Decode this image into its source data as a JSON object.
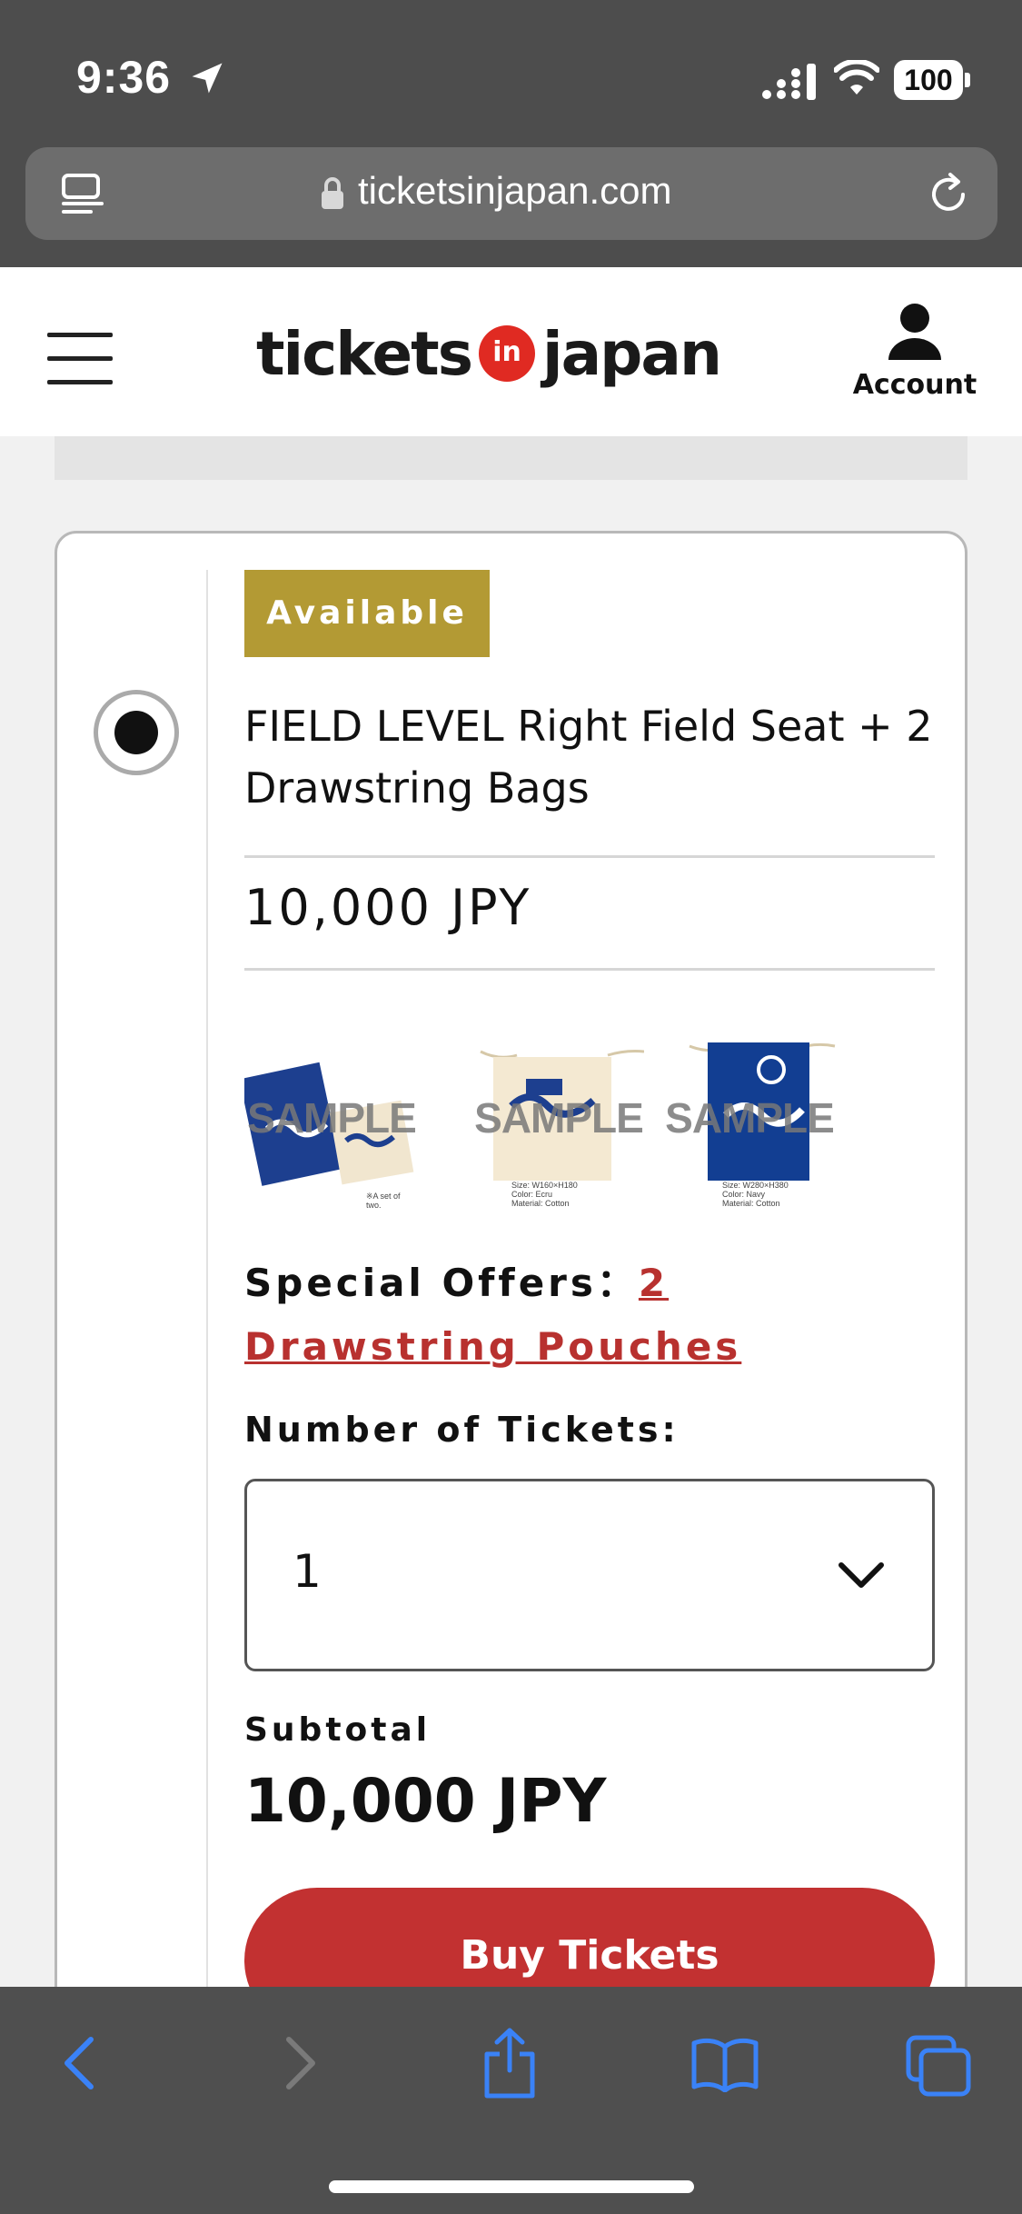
{
  "status_bar": {
    "time": "9:36",
    "battery": "100",
    "icons": [
      "location-arrow-icon",
      "cellular-signal-icon",
      "wifi-icon",
      "battery-icon"
    ]
  },
  "browser": {
    "url": "ticketsinjapan.com",
    "icons": [
      "reader-mode-icon",
      "lock-icon",
      "reload-icon"
    ]
  },
  "header": {
    "logo_left": "tickets",
    "logo_mid": "in",
    "logo_right": "japan",
    "account_label": "Account"
  },
  "ticket": {
    "badge": "Available",
    "title": "FIELD LEVEL Right Field Seat + 2 Drawstring Bags",
    "price": "10,000 JPY",
    "thumbnails": [
      {
        "watermark": "SAMPLE",
        "caption": "※A set of two."
      },
      {
        "watermark": "SAMPLE",
        "caption_lines": [
          "Size: W160×H180",
          "Color: Ecru",
          "Material: Cotton"
        ]
      },
      {
        "watermark": "SAMPLE",
        "caption_lines": [
          "Size: W280×H380",
          "Color: Navy",
          "Material: Cotton"
        ]
      }
    ],
    "special_offers_label": "Special Offers：",
    "special_offers_link": "2 Drawstring Pouches",
    "quantity_label": "Number of Tickets:",
    "quantity_value": "1",
    "subtotal_label": "Subtotal",
    "subtotal_value": "10,000 JPY",
    "buy_button": "Buy Tickets"
  },
  "toolbar": {
    "icons": [
      "back-icon",
      "forward-icon",
      "share-icon",
      "bookmarks-icon",
      "tabs-icon"
    ]
  },
  "colors": {
    "accent_red": "#c23131",
    "badge_gold": "#b39a34",
    "link_red": "#b8312f",
    "ios_blue": "#3a82f7"
  }
}
